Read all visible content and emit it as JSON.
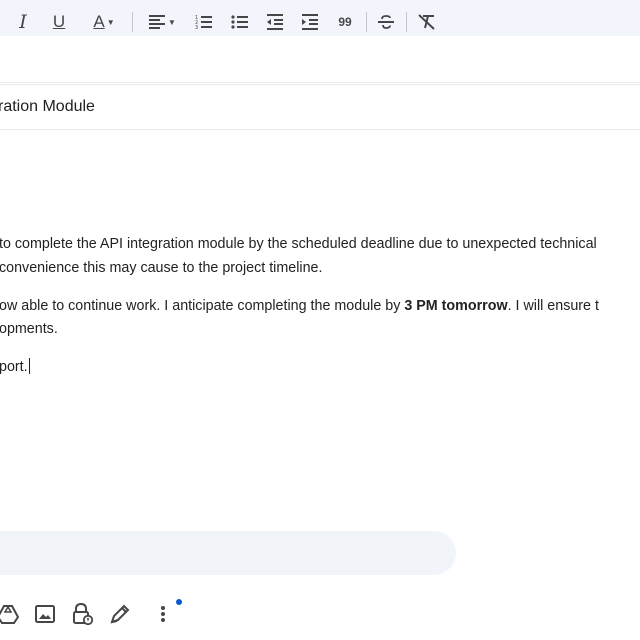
{
  "compose": {
    "subject": "ration Module",
    "paragraphs": [
      {
        "line1": "to complete the API integration module by the scheduled deadline due to unexpected technical",
        "line2": "convenience this may cause to the project timeline."
      },
      {
        "line1_before": "ow able to continue work. I anticipate completing the module by ",
        "line1_bold": "3 PM tomorrow",
        "line1_after": ". I will ensure t",
        "line2": "opments."
      },
      {
        "line1": "port."
      }
    ]
  },
  "toolbar": {
    "italic": "I",
    "underline": "U",
    "text_color": "A",
    "quote": "99"
  },
  "colors": {
    "topbar": "#f2f6fc",
    "toolbar_bg": "#f1f4f9",
    "notification_dot": "#0b57d0"
  },
  "icons": [
    "italic-icon",
    "underline-icon",
    "text-color-icon",
    "align-icon",
    "numbered-list-icon",
    "bulleted-list-icon",
    "indent-less-icon",
    "indent-more-icon",
    "quote-icon",
    "strikethrough-icon",
    "clear-formatting-icon",
    "drive-icon",
    "insert-photo-icon",
    "confidential-mode-icon",
    "signature-icon",
    "more-options-icon"
  ]
}
